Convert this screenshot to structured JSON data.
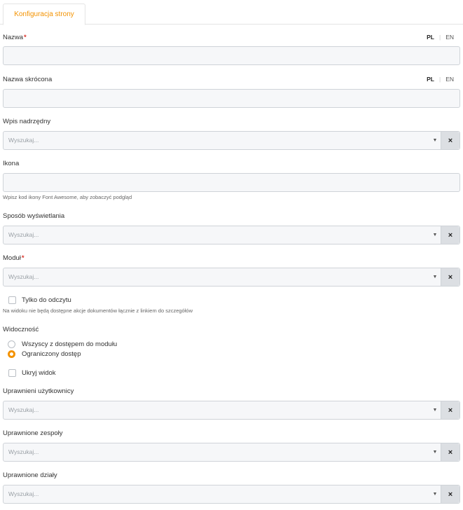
{
  "tabs": [
    {
      "label": "Konfiguracja strony"
    }
  ],
  "lang": {
    "pl": "PL",
    "en": "EN"
  },
  "required_mark": "*",
  "search_placeholder": "Wyszukaj...",
  "clear_glyph": "×",
  "caret_glyph": "▼",
  "fields": {
    "nazwa": {
      "label": "Nazwa",
      "value": ""
    },
    "nazwa_skrocona": {
      "label": "Nazwa skrócona",
      "value": ""
    },
    "wpis_nadrzedny": {
      "label": "Wpis nadrzędny"
    },
    "ikona": {
      "label": "Ikona",
      "value": "",
      "help": "Wpisz kod ikony Font Awesome, aby zobaczyć podgląd"
    },
    "sposob_wyswietlania": {
      "label": "Sposób wyświetlania"
    },
    "modul": {
      "label": "Moduł"
    },
    "tylko_do_odczytu": {
      "label": "Tylko do odczytu",
      "checked": false,
      "help": "Na widoku nie będą dostępne akcje dokumentów łącznie z linkiem do szczegółów"
    },
    "widocznosc": {
      "label": "Widoczność",
      "options": [
        {
          "label": "Wszyscy z dostępem do modułu",
          "checked": false
        },
        {
          "label": "Ograniczony dostęp",
          "checked": true
        }
      ]
    },
    "ukryj_widok": {
      "label": "Ukryj widok",
      "checked": false
    },
    "uprawnieni_uzytkownicy": {
      "label": "Uprawnieni użytkownicy"
    },
    "uprawnione_zespoly": {
      "label": "Uprawnione zespoły"
    },
    "uprawnione_dzialy": {
      "label": "Uprawnione działy"
    }
  },
  "colors": {
    "accent": "#f39200",
    "required": "#d9342b",
    "field_bg": "#f6f7f9",
    "clear_bg": "#dcdfe3"
  }
}
